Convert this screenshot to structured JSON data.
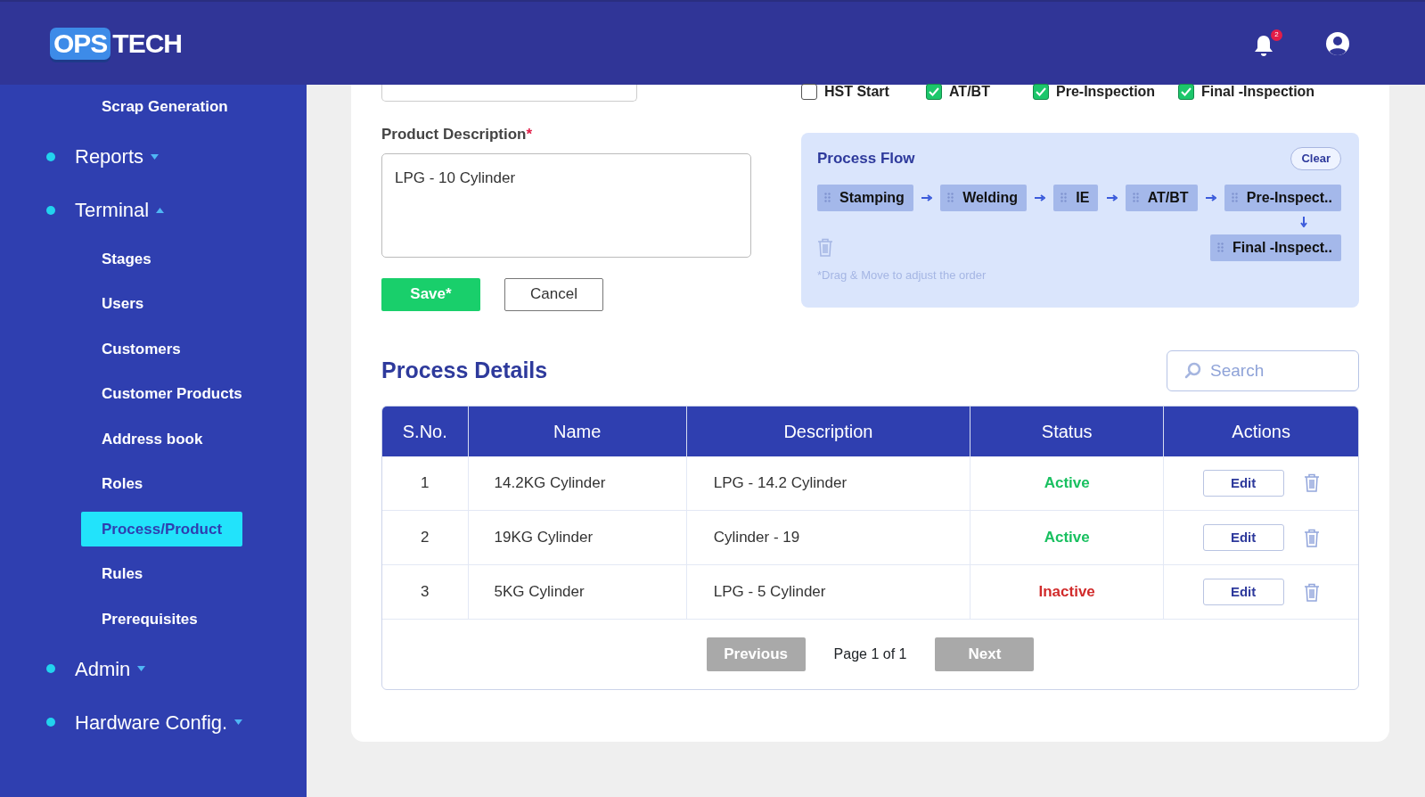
{
  "header": {
    "logo": {
      "part_1": "OPS",
      "part_2": "TECH"
    },
    "notification_count": "2"
  },
  "sidebar": {
    "items": [
      {
        "kind": "sub",
        "label": "Scrap Generation",
        "selected": false
      },
      {
        "kind": "group",
        "label": "Reports",
        "expanded": false
      },
      {
        "kind": "group",
        "label": "Terminal",
        "expanded": true,
        "children": [
          {
            "kind": "sub",
            "label": "Stages",
            "selected": false
          },
          {
            "kind": "sub",
            "label": "Users",
            "selected": false
          },
          {
            "kind": "sub",
            "label": "Customers",
            "selected": false
          },
          {
            "kind": "sub",
            "label": "Customer Products",
            "selected": false
          },
          {
            "kind": "sub",
            "label": "Address book",
            "selected": false
          },
          {
            "kind": "sub",
            "label": "Roles",
            "selected": false
          },
          {
            "kind": "sub",
            "label": "Process/Product",
            "selected": true
          },
          {
            "kind": "sub",
            "label": "Rules",
            "selected": false
          },
          {
            "kind": "sub",
            "label": "Prerequisites",
            "selected": false
          }
        ]
      },
      {
        "kind": "group",
        "label": "Admin",
        "expanded": false
      },
      {
        "kind": "group",
        "label": "Hardware Config.",
        "expanded": false
      }
    ]
  },
  "form": {
    "description_label": "Product Description",
    "required_mark": "*",
    "description_value": "LPG - 10 Cylinder",
    "save_button": "Save*",
    "cancel_button": "Cancel"
  },
  "checkboxes": [
    {
      "label": "HST Start",
      "checked": false
    },
    {
      "label": "AT/BT",
      "checked": true
    },
    {
      "label": "Pre-Inspection",
      "checked": true
    },
    {
      "label": "Final -Inspection",
      "checked": true
    }
  ],
  "process_flow": {
    "title": "Process Flow",
    "clear_button": "Clear",
    "steps": [
      {
        "label": "Stamping"
      },
      {
        "label": "Welding"
      },
      {
        "label": "IE"
      },
      {
        "label": "AT/BT"
      },
      {
        "label": "Pre-Inspect.."
      },
      {
        "label": "Final -Inspect.."
      }
    ],
    "hint": "*Drag & Move to adjust the order"
  },
  "process_details": {
    "title": "Process Details",
    "search": {
      "placeholder": "Search"
    },
    "table": {
      "columns": [
        "S.No.",
        "Name",
        "Description",
        "Status",
        "Actions"
      ],
      "rows": [
        {
          "sno": "1",
          "name": "14.2KG Cylinder",
          "description": "LPG - 14.2 Cylinder",
          "status": "Active",
          "active": true,
          "edit": "Edit"
        },
        {
          "sno": "2",
          "name": "19KG Cylinder",
          "description": "Cylinder - 19",
          "status": "Active",
          "active": true,
          "edit": "Edit"
        },
        {
          "sno": "3",
          "name": "5KG Cylinder",
          "description": "LPG - 5 Cylinder",
          "status": "Inactive",
          "active": false,
          "edit": "Edit"
        }
      ]
    },
    "pagination": {
      "previous": {
        "label": "Previous",
        "disabled": true
      },
      "page_info": "Page 1 of 1",
      "next": {
        "label": "Next",
        "disabled": true
      }
    }
  }
}
